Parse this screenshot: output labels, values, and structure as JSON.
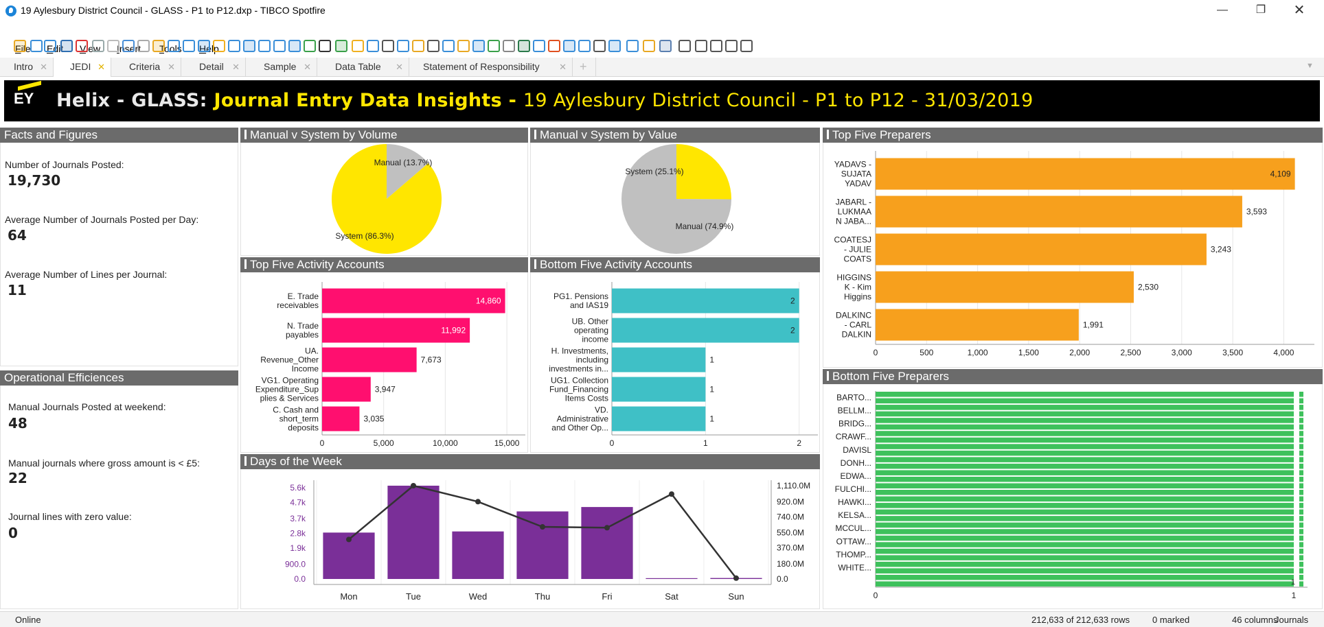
{
  "window": {
    "title": "19 Aylesbury District Council - GLASS - P1 to P12.dxp - TIBCO Spotfire"
  },
  "menu": [
    {
      "key": "F",
      "rest": "ile"
    },
    {
      "key": "E",
      "rest": "dit"
    },
    {
      "key": "V",
      "rest": "iew"
    },
    {
      "key": "I",
      "rest": "nsert"
    },
    {
      "key": "T",
      "rest": "ools"
    },
    {
      "key": "H",
      "rest": "elp"
    }
  ],
  "tabs": [
    {
      "label": "Intro"
    },
    {
      "label": "JEDI"
    },
    {
      "label": "Criteria"
    },
    {
      "label": "Detail"
    },
    {
      "label": "Sample"
    },
    {
      "label": "Data Table"
    },
    {
      "label": "Statement of Responsibility"
    }
  ],
  "banner": {
    "logo": "EY",
    "part1": "Helix - GLASS:",
    "part2": "Journal Entry Data Insights -",
    "part3": "19 Aylesbury District Council - P1 to P12 - 31/03/2019"
  },
  "facts": {
    "title": "Facts and Figures",
    "items": [
      {
        "label": "Number of Journals Posted:",
        "value": "19,730"
      },
      {
        "label": "Average Number of Journals Posted per Day:",
        "value": "64"
      },
      {
        "label": "Average Number of Lines per Journal:",
        "value": "11"
      }
    ]
  },
  "ops": {
    "title": "Operational Efficiences",
    "items": [
      {
        "label": "Manual Journals Posted at weekend:",
        "value": "48"
      },
      {
        "label": "Manual journals where gross amount is < £5:",
        "value": "22"
      },
      {
        "label": "Journal lines with zero value:",
        "value": "0"
      }
    ]
  },
  "panel_titles": {
    "pie_volume": "Manual v System by Volume",
    "pie_value": "Manual v System by Value",
    "top_accounts": "Top Five Activity Accounts",
    "bottom_accounts": "Bottom Five Activity Accounts",
    "top_preparers": "Top Five Preparers",
    "bottom_preparers": "Bottom Five Preparers",
    "days": "Days of the Week"
  },
  "colors": {
    "yellow": "#ffe600",
    "grey": "#c0c0c0",
    "pink": "#ff0f6f",
    "teal": "#3fc0c6",
    "orange": "#f7a01d",
    "green": "#3ec15c",
    "purple": "#7a2f98",
    "line": "#333333"
  },
  "chart_data": [
    {
      "id": "pie_volume",
      "type": "pie",
      "labels": [
        "Manual (13.7%)",
        "System (86.3%)"
      ],
      "values": [
        13.7,
        86.3
      ]
    },
    {
      "id": "pie_value",
      "type": "pie",
      "labels": [
        "System (25.1%)",
        "Manual (74.9%)"
      ],
      "values": [
        25.1,
        74.9
      ]
    },
    {
      "id": "top_accounts",
      "type": "bar",
      "orientation": "horizontal",
      "categories": [
        [
          "E. Trade",
          "receivables"
        ],
        [
          "N. Trade",
          "payables"
        ],
        [
          "UA.",
          "Revenue_Other",
          "Income"
        ],
        [
          "VG1. Operating",
          "Expenditure_Sup",
          "plies & Services"
        ],
        [
          "C. Cash and",
          "short_term",
          "deposits"
        ]
      ],
      "values": [
        14860,
        11992,
        7673,
        3947,
        3035
      ],
      "value_labels": [
        "14,860",
        "11,992",
        "7,673",
        "3,947",
        "3,035"
      ],
      "xlim": [
        0,
        16500
      ],
      "ticks": [
        0,
        5000,
        10000,
        15000
      ],
      "tick_labels": [
        "0",
        "5,000",
        "10,000",
        "15,000"
      ]
    },
    {
      "id": "bottom_accounts",
      "type": "bar",
      "orientation": "horizontal",
      "categories": [
        [
          "PG1. Pensions",
          "and IAS19"
        ],
        [
          "UB. Other",
          "operating",
          "income"
        ],
        [
          "H. Investments,",
          "including",
          "investments in..."
        ],
        [
          "UG1. Collection",
          "Fund_Financing",
          "Items Costs"
        ],
        [
          "VD.",
          "Administrative",
          "and Other Op..."
        ]
      ],
      "values": [
        2,
        2,
        1,
        1,
        1
      ],
      "value_labels": [
        "2",
        "2",
        "1",
        "1",
        "1"
      ],
      "xlim": [
        0,
        2.2
      ],
      "ticks": [
        0,
        1,
        2
      ],
      "tick_labels": [
        "0",
        "1",
        "2"
      ]
    },
    {
      "id": "top_preparers",
      "type": "bar",
      "orientation": "horizontal",
      "categories": [
        [
          "YADAVS -",
          "SUJATA",
          "YADAV"
        ],
        [
          "JABARL -",
          "LUKMAA",
          "N JABA..."
        ],
        [
          "COATESJ",
          "- JULIE",
          "COATS"
        ],
        [
          "HIGGINS",
          "K - Kim",
          "Higgins"
        ],
        [
          "DALKINC",
          "- CARL",
          "DALKIN"
        ]
      ],
      "values": [
        4109,
        3593,
        3243,
        2530,
        1991
      ],
      "value_labels": [
        "4,109",
        "3,593",
        "3,243",
        "2,530",
        "1,991"
      ],
      "xlim": [
        0,
        4300
      ],
      "ticks": [
        0,
        500,
        1000,
        1500,
        2000,
        2500,
        3000,
        3500,
        4000
      ],
      "tick_labels": [
        "0",
        "500",
        "1,000",
        "1,500",
        "2,000",
        "2,500",
        "3,000",
        "3,500",
        "4,000"
      ]
    },
    {
      "id": "bottom_preparers",
      "type": "bar",
      "orientation": "horizontal",
      "categories": [
        "BARTO...",
        "BELLM...",
        "BRIDG...",
        "CRAWF...",
        "DAVISL",
        "DONH...",
        "EDWA...",
        "FULCHI...",
        "HAWKI...",
        "KELSA...",
        "MCCUL...",
        "OTTAW...",
        "THOMP...",
        "WHITE..."
      ],
      "values": [
        1,
        1,
        1,
        1,
        1,
        1,
        1,
        1,
        1,
        1,
        1,
        1,
        1,
        1
      ],
      "value_labels": [
        "1"
      ],
      "xlim": [
        0,
        1
      ],
      "ticks": [
        0,
        1
      ],
      "tick_labels": [
        "0",
        "1"
      ]
    },
    {
      "id": "days",
      "type": "bar",
      "categories": [
        "Mon",
        "Tue",
        "Wed",
        "Thu",
        "Fri",
        "Sat",
        "Sun"
      ],
      "series": [
        {
          "values": [
            2850,
            5730,
            2920,
            4150,
            4420,
            50,
            60
          ]
        },
        {
          "values": [
            470,
            1110,
            920,
            620,
            610,
            1010,
            10
          ]
        }
      ],
      "y_ticks": [
        0,
        900,
        1900,
        2800,
        3700,
        4700,
        5600
      ],
      "y_tick_labels": [
        "0.0",
        "900.0",
        "1.9k",
        "2.8k",
        "3.7k",
        "4.7k",
        "5.6k"
      ],
      "y2_ticks": [
        0,
        180,
        370,
        550,
        740,
        920,
        1110
      ],
      "y2_tick_labels": [
        "0.0",
        "180.0M",
        "370.0M",
        "550.0M",
        "740.0M",
        "920.0M",
        "1,110.0M"
      ],
      "ylim": [
        0,
        5730
      ],
      "y2lim": [
        0,
        1110
      ]
    }
  ],
  "status": {
    "left": "Online",
    "rows": "212,633 of 212,633 rows",
    "marked": "0 marked",
    "columns": "46 columns",
    "table": "Journals"
  }
}
